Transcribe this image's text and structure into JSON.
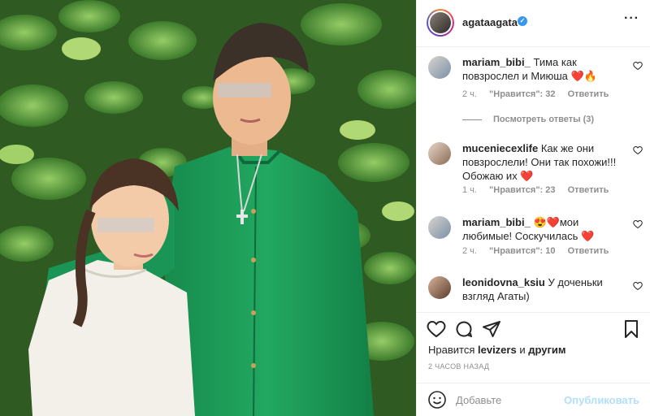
{
  "post": {
    "image_alt": "",
    "author": {
      "username": "agataagata",
      "verified": true
    },
    "more_icon": "more-horizontal-icon",
    "comments": [
      {
        "username": "mariam_bibi_",
        "text": "Тима как повзрослел и Миюша ❤️🔥",
        "time": "2 ч.",
        "likes": "\"Нравится\": 32",
        "reply": "Ответить",
        "view_replies": "Посмотреть ответы (3)"
      },
      {
        "username": "muceniecexlife",
        "text": "Как же они повзрослели! Они так похожи!!! Обожаю их ❤️",
        "time": "1 ч.",
        "likes": "\"Нравится\": 23",
        "reply": "Ответить"
      },
      {
        "username": "mariam_bibi_",
        "text": "😍❤️мои любимые! Соскучилась ❤️",
        "time": "2 ч.",
        "likes": "\"Нравится\": 10",
        "reply": "Ответить"
      },
      {
        "username": "leonidovna_ksiu",
        "text": "У доченьки взгляд Агаты)"
      }
    ],
    "likes_prefix": "Нравится",
    "likes_user": "levizers",
    "likes_joiner": "и",
    "likes_suffix": "другим",
    "time_ago": "2 ЧАСОВ НАЗАД",
    "add_comment_placeholder": "Добавьте",
    "publish_label": "Опубликовать"
  },
  "colors": {
    "verified": "#3897f0",
    "publish": "#b2dffc",
    "heart": "#ed4956",
    "shirt": "#1fa05a"
  },
  "icons": [
    "heart-icon",
    "comment-icon",
    "share-icon",
    "bookmark-icon",
    "emoji-icon"
  ]
}
